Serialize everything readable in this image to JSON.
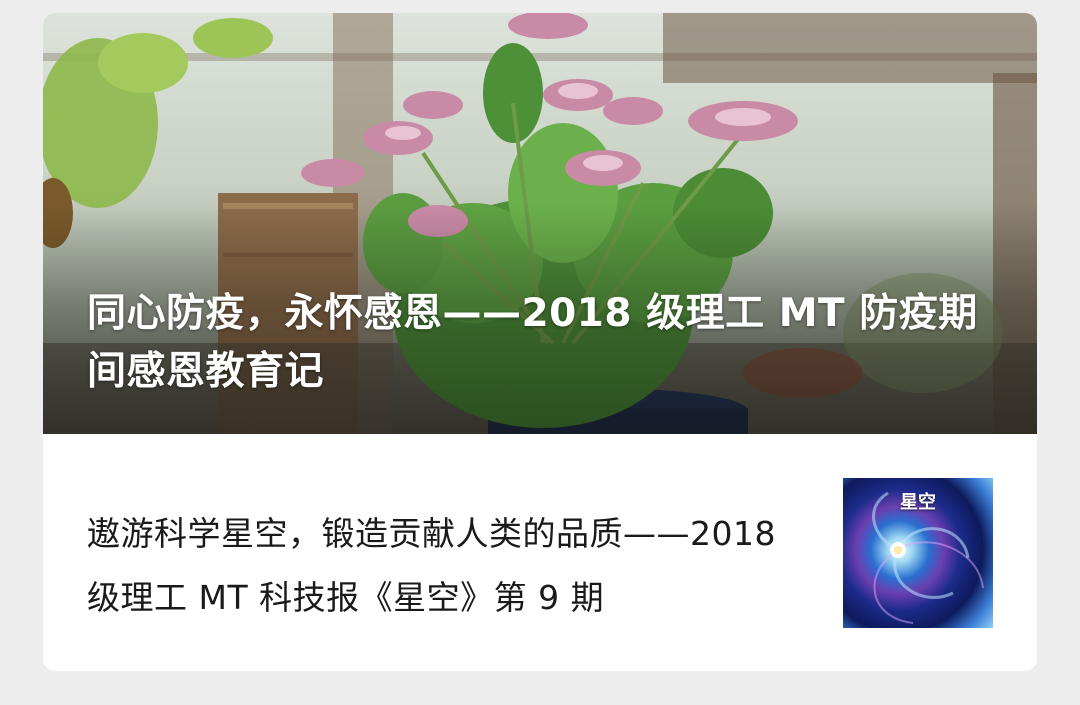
{
  "hero": {
    "title": "同心防疫，永怀感恩——2018 级理工 MT 防疫期间感恩教育记"
  },
  "article": {
    "title": "遨游科学星空，锻造贡献人类的品质——2018 级理工 MT 科技报《星空》第 9 期",
    "thumbnail_text": "星空"
  },
  "colors": {
    "page_background": "#ededed",
    "card_background": "#ffffff",
    "title_text": "#1a1a1a",
    "hero_text": "#ffffff"
  }
}
